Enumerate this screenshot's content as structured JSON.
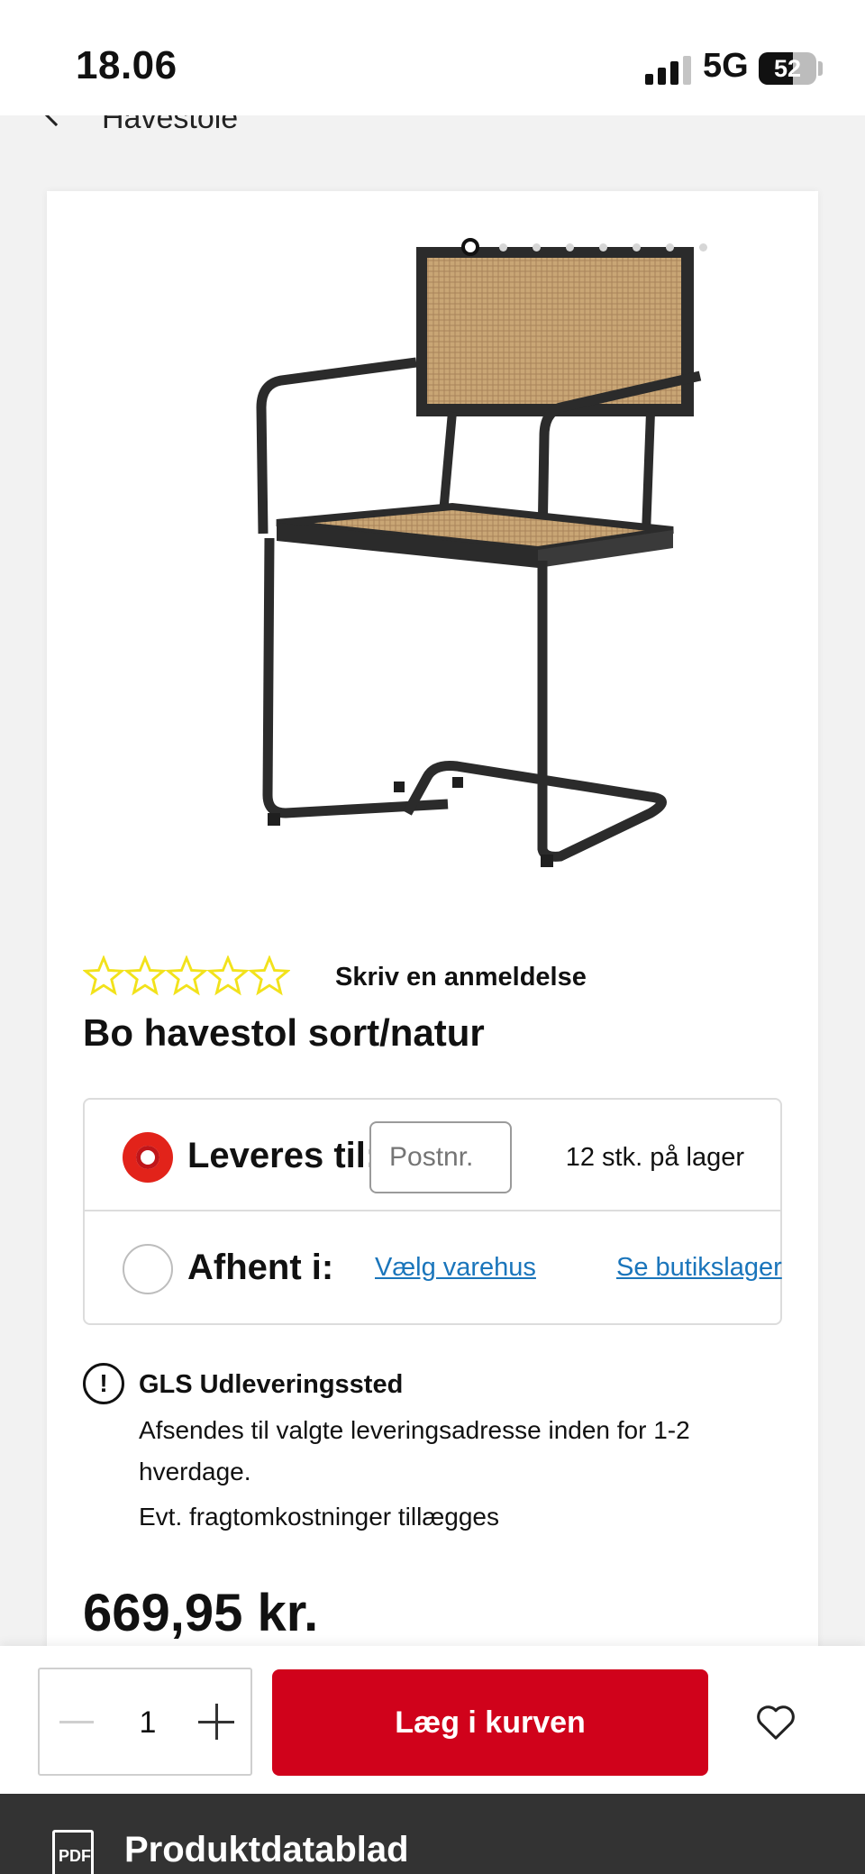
{
  "status_bar": {
    "time": "18.06",
    "network": "5G",
    "battery_level": "52"
  },
  "nav": {
    "back_label": "Havestole"
  },
  "gallery": {
    "image_count": 8,
    "active_index": 0
  },
  "product": {
    "rating_stars": 0,
    "rating_max": 5,
    "review_link": "Skriv en anmeldelse",
    "title": "Bo havestol sort/natur",
    "price": "669,95 kr."
  },
  "delivery": {
    "ship_label": "Leveres til:",
    "postcode_placeholder": "Postnr.",
    "stock_text": "12 stk. på lager",
    "pickup_label": "Afhent i:",
    "choose_store_link": "Vælg varehus",
    "store_stock_link": "Se butikslager",
    "selected_option": "ship"
  },
  "info": {
    "title": "GLS Udleveringssted",
    "line1": "Afsendes til valgte leveringsadresse inden for 1-2 hverdage.",
    "line2": "Evt. fragtomkostninger tillægges"
  },
  "cart_bar": {
    "quantity": "1",
    "add_to_cart": "Læg i kurven"
  },
  "datasheet": {
    "icon_text": "PDF",
    "label": "Produktdatablad"
  },
  "colors": {
    "accent_red": "#d0021b",
    "link_blue": "#1a75bb",
    "star_yellow": "#f2e21b",
    "footer_dark": "#333333"
  }
}
